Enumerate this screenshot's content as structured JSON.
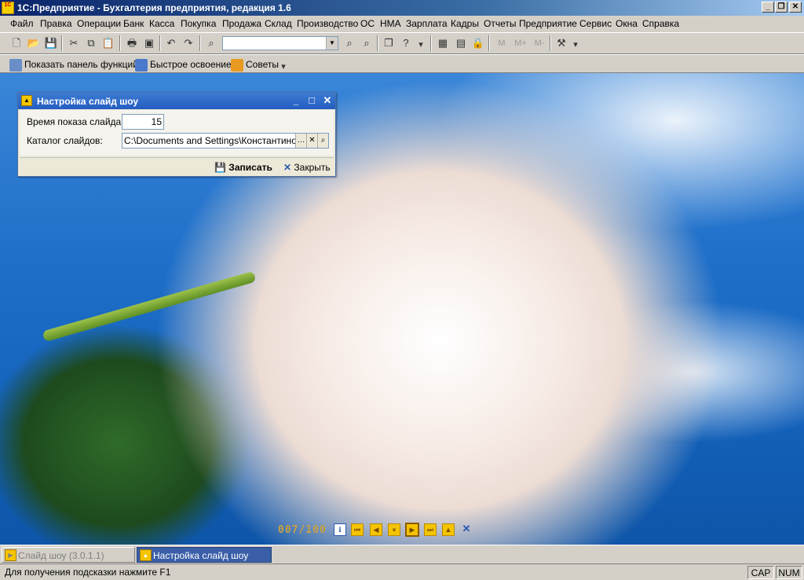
{
  "window": {
    "title": "1С:Предприятие - Бухгалтерия предприятия, редакция 1.6",
    "icon_text": "1С"
  },
  "menu": [
    "Файл",
    "Правка",
    "Операции",
    "Банк",
    "Касса",
    "Покупка",
    "Продажа",
    "Склад",
    "Производство",
    "ОС",
    "НМА",
    "Зарплата",
    "Кадры",
    "Отчеты",
    "Предприятие",
    "Сервис",
    "Окна",
    "Справка"
  ],
  "toolbar2": {
    "functions_panel": "Показать панель функций",
    "quick_learn": "Быстрое освоение",
    "tips": "Советы"
  },
  "toolbar_icons": [
    "new-icon",
    "open-icon",
    "save-icon",
    "cut-icon",
    "copy-icon",
    "paste-icon",
    "print-icon",
    "preview-icon",
    "undo-icon",
    "redo-icon",
    "find-icon",
    "search-combo",
    "find-next-icon",
    "find-prev-icon",
    "windows-icon",
    "help-icon",
    "calculator-icon",
    "calendar-icon",
    "lock-icon",
    "memory-icon",
    "memory-plus-icon",
    "memory-minus-icon",
    "tools-icon"
  ],
  "toolbar_text": {
    "m": "M",
    "m_plus": "M+",
    "m_minus": "M-"
  },
  "dialog": {
    "title": "Настройка слайд шоу",
    "interval_label": "Время показа слайда:",
    "interval_value": "15",
    "folder_label": "Каталог слайдов:",
    "folder_value": "C:\\Documents and Settings\\Константинов.И",
    "save_label": "Записать",
    "close_label": "Закрыть"
  },
  "player": {
    "counter": "007/100"
  },
  "taskbar": [
    "Слайд шоу (3.0.1.1)",
    "Настройка слайд шоу"
  ],
  "status": {
    "hint": "Для получения подсказки нажмите F1",
    "cap": "CAP",
    "num": "NUM"
  },
  "colors": {
    "title_bar": "#0a246a",
    "dialog_title": "#245dc1",
    "player_accent": "#f5c400",
    "counter": "#c8a040"
  }
}
